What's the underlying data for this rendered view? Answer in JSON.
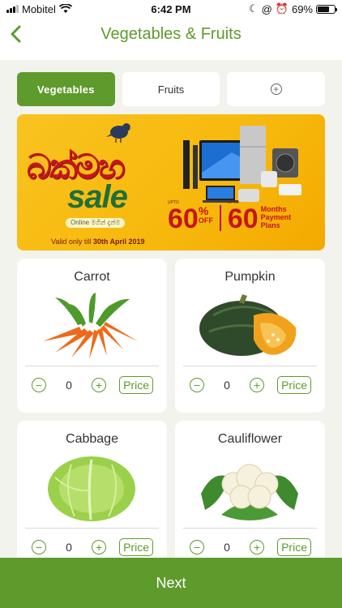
{
  "status_bar": {
    "carrier": "Mobitel",
    "time": "6:42 PM",
    "battery": "69%",
    "battery_level": 0.69,
    "icons": [
      "signal-icon",
      "wifi-icon",
      "moon-icon",
      "at-icon",
      "alarm-icon",
      "battery-icon"
    ]
  },
  "header": {
    "title": "Vegetables & Fruits",
    "back_icon": "chevron-left-icon"
  },
  "tabs": [
    {
      "label": "Vegetables",
      "active": true
    },
    {
      "label": "Fruits",
      "active": false
    },
    {
      "label": "",
      "icon": "plus-circle-icon",
      "active": false
    }
  ],
  "banner": {
    "sinhala_text": "බක්මහ",
    "sale_text": "sale",
    "online_text": "Online මගින් දැන්ම",
    "valid_prefix": "Valid only till ",
    "valid_date": "30th April 2019",
    "offer_1_value": "60",
    "offer_1_unit": "%",
    "offer_1_label": "OFF",
    "offer_1_upto": "UPTO",
    "offer_2_value": "60",
    "offer_2_label_1": "Months",
    "offer_2_label_2": "Payment",
    "offer_2_label_3": "Plans",
    "offer_2_upto": "UPTO"
  },
  "products": [
    {
      "name": "Carrot",
      "quantity": "0",
      "price_label": "Price",
      "image": "carrot-image"
    },
    {
      "name": "Pumpkin",
      "quantity": "0",
      "price_label": "Price",
      "image": "pumpkin-image"
    },
    {
      "name": "Cabbage",
      "quantity": "0",
      "price_label": "Price",
      "image": "cabbage-image"
    },
    {
      "name": "Cauliflower",
      "quantity": "0",
      "price_label": "Price",
      "image": "cauliflower-image"
    }
  ],
  "footer": {
    "next_label": "Next"
  },
  "colors": {
    "brand_green": "#5e9a2c",
    "background": "#f3f3ee",
    "banner_yellow": "#f9c31f",
    "banner_red": "#c5161d"
  }
}
